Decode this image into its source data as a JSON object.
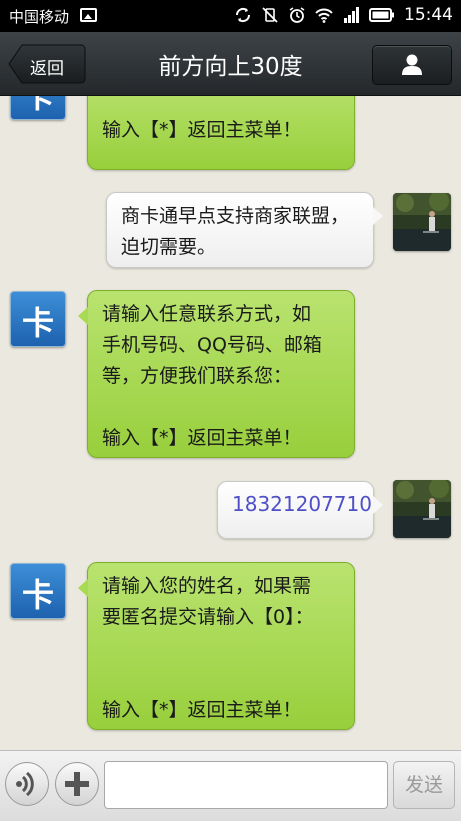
{
  "status_bar": {
    "carrier": "中国移动",
    "time": "15:44"
  },
  "header": {
    "back_label": "返回",
    "title": "前方向上30度"
  },
  "avatar_card_text": "卡",
  "messages": [
    {
      "from": "bot",
      "lines": [
        "输入【*】返回主菜单！"
      ]
    },
    {
      "from": "user",
      "lines": [
        "商卡通早点支持商家联盟，",
        "迫切需要。"
      ]
    },
    {
      "from": "bot",
      "lines": [
        "请输入任意联系方式，如",
        "手机号码、QQ号码、邮箱",
        "等，方便我们联系您：",
        "",
        "输入【*】返回主菜单！"
      ]
    },
    {
      "from": "user",
      "lines": [
        "18321207710"
      ]
    },
    {
      "from": "bot",
      "lines": [
        "请输入您的姓名，如果需",
        "要匿名提交请输入【0】：",
        "",
        "",
        "输入【*】返回主菜单！"
      ]
    }
  ],
  "input": {
    "placeholder": "",
    "send_label": "发送"
  }
}
